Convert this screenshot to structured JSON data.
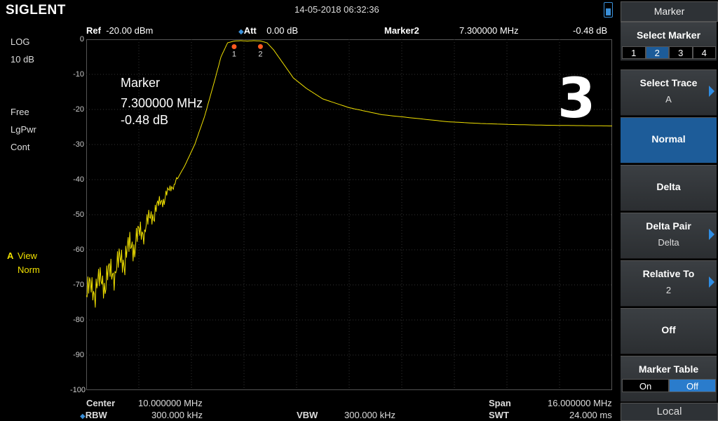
{
  "header": {
    "brand": "SIGLENT",
    "datetime": "14-05-2018   06:32:36",
    "ref_label": "Ref",
    "ref_value": "-20.00 dBm",
    "att_label": "Att",
    "att_value": "0.00 dB",
    "marker_label": "Marker2",
    "marker_freq": "7.300000 MHz",
    "marker_level": "-0.48 dB"
  },
  "left": {
    "scale_type": "LOG",
    "scale_div": "10 dB",
    "trig": "Free",
    "detector": "LgPwr",
    "sweep": "Cont",
    "trace_letter": "A",
    "trace_view": "View",
    "trace_mode": "Norm"
  },
  "y_ticks": [
    "0",
    "-10",
    "-20",
    "-30",
    "-40",
    "-50",
    "-60",
    "-70",
    "-80",
    "-90",
    "-100"
  ],
  "marker_annotation": {
    "title": "Marker",
    "freq": "7.300000 MHz",
    "level": "-0.48 dB",
    "marker1_label": "1",
    "marker2_label": "2"
  },
  "overlay_number": "3",
  "bottom": {
    "center_label": "Center",
    "center_value": "10.000000 MHz",
    "span_label": "Span",
    "span_value": "16.000000 MHz",
    "rbw_label": "RBW",
    "rbw_value": "300.000 kHz",
    "vbw_label": "VBW",
    "vbw_value": "300.000 kHz",
    "swt_label": "SWT",
    "swt_value": "24.000 ms"
  },
  "panel": {
    "title": "Marker",
    "select_marker": "Select Marker",
    "markers": [
      "1",
      "2",
      "3",
      "4"
    ],
    "selected_marker": "2",
    "select_trace": "Select Trace",
    "select_trace_value": "A",
    "normal": "Normal",
    "delta": "Delta",
    "delta_pair": "Delta Pair",
    "delta_pair_value": "Delta",
    "relative_to": "Relative To",
    "relative_to_value": "2",
    "off": "Off",
    "marker_table": "Marker Table",
    "table_on": "On",
    "table_off": "Off",
    "local": "Local"
  },
  "colors": {
    "trace": "#f0e000",
    "accent": "#1d5c99",
    "marker": "#ff5a1f"
  },
  "chart_data": {
    "type": "line",
    "x_start_mhz": 2.0,
    "x_stop_mhz": 18.0,
    "ylim": [
      -100,
      0
    ],
    "grid": true,
    "series": [
      {
        "x": [
          2.0,
          2.3,
          2.6,
          2.9,
          3.2,
          3.5,
          3.8,
          4.1,
          4.4,
          4.7,
          5.0,
          5.3,
          5.6,
          5.9,
          6.1,
          6.3,
          6.5,
          6.7,
          6.9,
          7.1,
          7.3,
          7.5,
          7.7,
          8.0,
          8.3,
          8.7,
          9.2,
          10.0,
          11.0,
          12.0,
          13.0,
          14.0,
          15.0,
          16.0,
          17.0,
          18.0
        ],
        "values": [
          -73,
          -71,
          -69,
          -66,
          -62,
          -58,
          -54,
          -49,
          -45,
          -41,
          -36,
          -30,
          -22,
          -12,
          -5,
          -1,
          -0.5,
          -0.4,
          -0.5,
          -0.4,
          -0.48,
          -1,
          -3,
          -7,
          -11,
          -14,
          -17,
          -19.5,
          -21.5,
          -22.5,
          -23.5,
          -24,
          -24.3,
          -24.5,
          -24.6,
          -24.7
        ]
      }
    ],
    "markers": [
      {
        "label": "1",
        "x": 6.5,
        "y": -0.5
      },
      {
        "label": "2",
        "x": 7.3,
        "y": -0.48
      }
    ]
  }
}
